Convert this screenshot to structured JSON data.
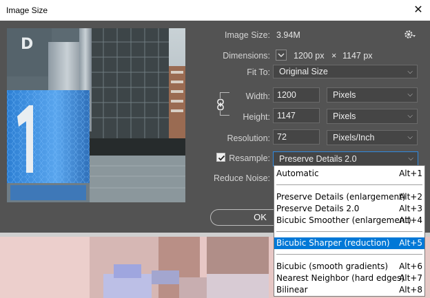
{
  "window": {
    "title": "Image Size",
    "close_glyph": "✕"
  },
  "image_size": {
    "label": "Image Size:",
    "value": "3.94M"
  },
  "dimensions": {
    "label": "Dimensions:",
    "width": "1200 px",
    "times": "×",
    "height": "1147 px"
  },
  "fit_to": {
    "label": "Fit To:",
    "value": "Original Size"
  },
  "width": {
    "label": "Width:",
    "value": "1200",
    "unit": "Pixels"
  },
  "height": {
    "label": "Height:",
    "value": "1147",
    "unit": "Pixels"
  },
  "resolution": {
    "label": "Resolution:",
    "value": "72",
    "unit": "Pixels/Inch"
  },
  "resample": {
    "label": "Resample:",
    "checked": true,
    "value": "Preserve Details 2.0"
  },
  "reduce_noise": {
    "label": "Reduce Noise:"
  },
  "ok": {
    "label": "OK"
  },
  "dropdown": {
    "items": [
      {
        "label": "Automatic",
        "shortcut": "Alt+1"
      },
      {
        "label": "Preserve Details (enlargement)",
        "shortcut": "Alt+2"
      },
      {
        "label": "Preserve Details 2.0",
        "shortcut": "Alt+3"
      },
      {
        "label": "Bicubic Smoother (enlargement)",
        "shortcut": "Alt+4"
      },
      {
        "label": "Bicubic Sharper (reduction)",
        "shortcut": "Alt+5",
        "selected": true
      },
      {
        "label": "Bicubic (smooth gradients)",
        "shortcut": "Alt+6"
      },
      {
        "label": "Nearest Neighbor (hard edges)",
        "shortcut": "Alt+7"
      },
      {
        "label": "Bilinear",
        "shortcut": "Alt+8"
      }
    ]
  },
  "icons": {
    "gear": "gear-icon",
    "link": "link-icon",
    "chevron": "chevron-down-icon",
    "eye": "chevron-down-icon"
  },
  "colors": {
    "dialog_bg": "#535353",
    "field_bg": "#454545",
    "highlight": "#0078d7"
  }
}
